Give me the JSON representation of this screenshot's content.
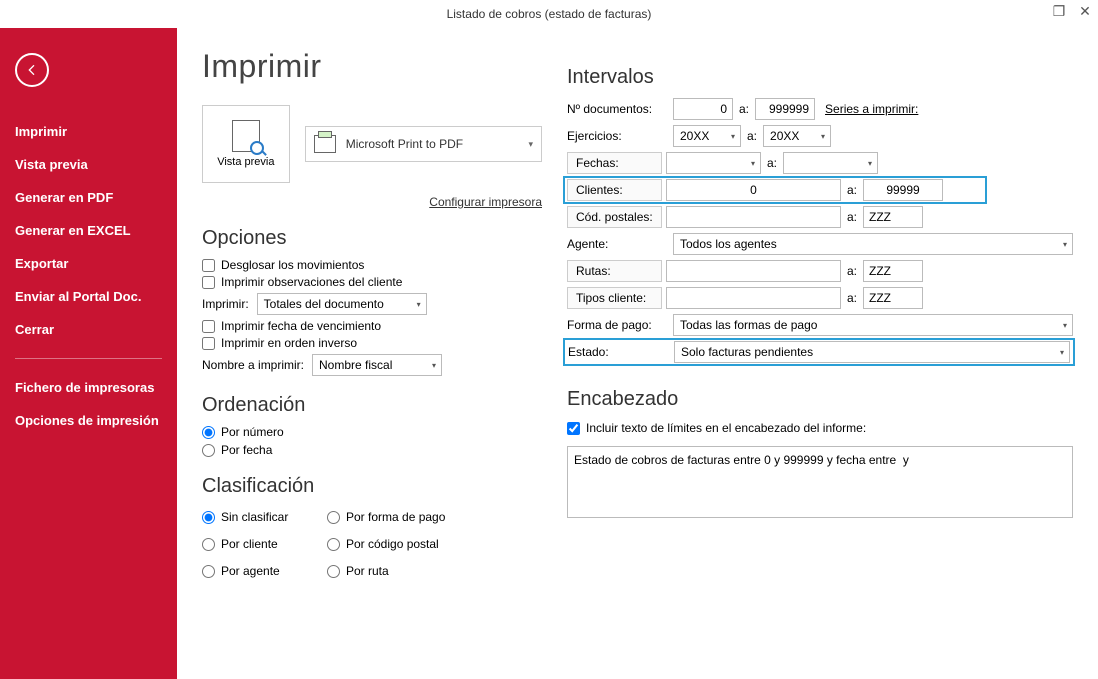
{
  "window": {
    "title": "Listado de cobros (estado de facturas)"
  },
  "sidebar": {
    "items": [
      "Imprimir",
      "Vista previa",
      "Generar en PDF",
      "Generar en EXCEL",
      "Exportar",
      "Enviar al Portal Doc.",
      "Cerrar"
    ],
    "footer": [
      "Fichero de impresoras",
      "Opciones de impresión"
    ]
  },
  "page": {
    "title": "Imprimir",
    "vista_previa": "Vista previa",
    "printer": "Microsoft Print to PDF",
    "config_link": "Configurar impresora"
  },
  "opciones": {
    "heading": "Opciones",
    "desglosar": "Desglosar los movimientos",
    "obs": "Imprimir observaciones del cliente",
    "imprimir_label": "Imprimir:",
    "imprimir_value": "Totales del documento",
    "fecha_venc": "Imprimir fecha de vencimiento",
    "orden_inv": "Imprimir en orden inverso",
    "nombre_label": "Nombre a imprimir:",
    "nombre_value": "Nombre fiscal"
  },
  "ordenacion": {
    "heading": "Ordenación",
    "por_numero": "Por número",
    "por_fecha": "Por fecha"
  },
  "clasificacion": {
    "heading": "Clasificación",
    "opts": [
      "Sin clasificar",
      "Por forma de pago",
      "Por cliente",
      "Por código postal",
      "Por agente",
      "Por ruta"
    ]
  },
  "intervalos": {
    "heading": "Intervalos",
    "ndoc_label": "Nº documentos:",
    "ndoc_from": "0",
    "ndoc_to": "999999",
    "series": "Series a imprimir:",
    "ejerc_label": "Ejercicios:",
    "ejerc_from": "20XX",
    "ejerc_to": "20XX",
    "fechas": "Fechas:",
    "clientes": "Clientes:",
    "cli_from": "0",
    "cli_to": "99999",
    "codpost": "Cód. postales:",
    "cp_to": "ZZZ",
    "agente_label": "Agente:",
    "agente_value": "Todos los agentes",
    "rutas": "Rutas:",
    "rutas_to": "ZZZ",
    "tiposcli": "Tipos cliente:",
    "tipos_to": "ZZZ",
    "fpago_label": "Forma de pago:",
    "fpago_value": "Todas las formas de pago",
    "estado_label": "Estado:",
    "estado_value": "Solo facturas pendientes",
    "a": "a:"
  },
  "encabezado": {
    "heading": "Encabezado",
    "chk": "Incluir texto de límites en el encabezado del informe:",
    "text": "Estado de cobros de facturas entre 0 y 999999 y fecha entre  y"
  }
}
